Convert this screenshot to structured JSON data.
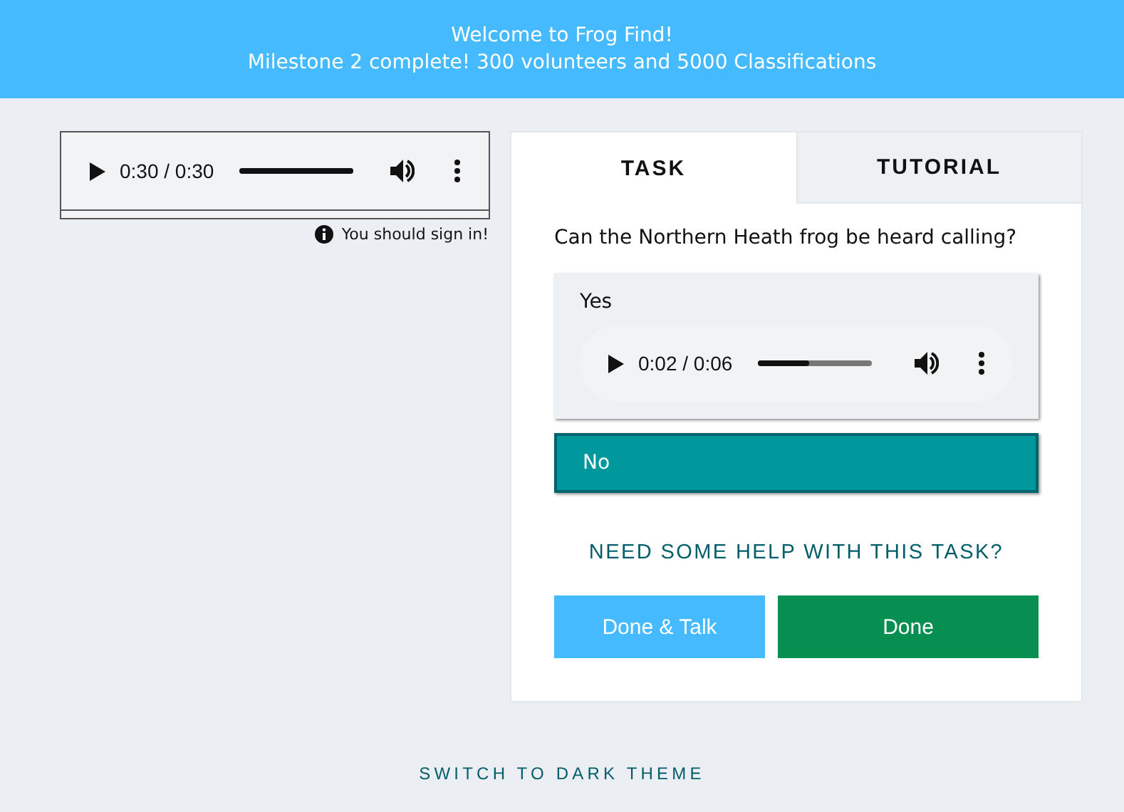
{
  "banner": {
    "title": "Welcome to Frog Find!",
    "message": "Milestone 2 complete! 300 volunteers and 5000 Classifications"
  },
  "subject_player": {
    "time": "0:30 / 0:30",
    "level": 1
  },
  "sign_in_notice": "You should sign in!",
  "tabs": [
    {
      "label": "TASK",
      "selected": true
    },
    {
      "label": "TUTORIAL",
      "selected": false
    }
  ],
  "question": "Can the Northern Heath frog be heard calling?",
  "answers": [
    {
      "label": "Yes",
      "selected": false,
      "player": {
        "time": "0:02 / 0:06",
        "level": 0.45
      }
    },
    {
      "label": "No",
      "selected": true
    }
  ],
  "help_link": "NEED SOME HELP WITH THIS TASK?",
  "buttons": [
    {
      "label": "Done & Talk",
      "kind": "talk"
    },
    {
      "label": "Done",
      "kind": "done"
    }
  ],
  "theme_link": "SWITCH TO DARK THEME"
}
